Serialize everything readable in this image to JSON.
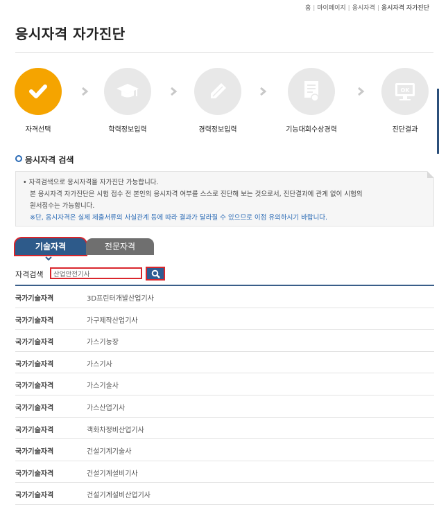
{
  "breadcrumb": {
    "items": [
      "홈",
      "마이페이지",
      "응시자격",
      "응시자격 자가진단"
    ]
  },
  "page_title": "응시자격 자가진단",
  "steps": [
    {
      "label": "자격선택",
      "icon": "check-icon",
      "active": true
    },
    {
      "label": "학력정보입력",
      "icon": "graduation-cap-icon",
      "active": false
    },
    {
      "label": "경력정보입력",
      "icon": "pencil-icon",
      "active": false
    },
    {
      "label": "기능대회수상경력",
      "icon": "certificate-icon",
      "active": false
    },
    {
      "label": "진단결과",
      "icon": "ok-monitor-icon",
      "active": false
    }
  ],
  "section_title": "응시자격 검색",
  "notice": {
    "line1": "자격검색으로 응시자격을 자가진단 가능합니다.",
    "line2": "본 응시자격 자가진단은 시험 접수 전 본인의 응시자격 여부를 스스로 진단해 보는 것으로서, 진단결과에 관계 없이 시험의",
    "line3": "원서접수는 가능합니다.",
    "line4": "※단, 응시자격은 실제 제출서류의 사실관계 등에 따라 결과가 달라질 수 있으므로 이점 유의하시기 바랍니다."
  },
  "tabs": {
    "tech": "기술자격",
    "pro": "전문자격"
  },
  "search": {
    "label": "자격검색",
    "value": "산업안전기사"
  },
  "results": [
    {
      "type": "국가기술자격",
      "name": "3D프린터개발산업기사"
    },
    {
      "type": "국가기술자격",
      "name": "가구제작산업기사"
    },
    {
      "type": "국가기술자격",
      "name": "가스기능장"
    },
    {
      "type": "국가기술자격",
      "name": "가스기사"
    },
    {
      "type": "국가기술자격",
      "name": "가스기술사"
    },
    {
      "type": "국가기술자격",
      "name": "가스산업기사"
    },
    {
      "type": "국가기술자격",
      "name": "객화차정비산업기사"
    },
    {
      "type": "국가기술자격",
      "name": "건설기계기술사"
    },
    {
      "type": "국가기술자격",
      "name": "건설기계설비기사"
    },
    {
      "type": "국가기술자격",
      "name": "건설기계설비산업기사"
    }
  ],
  "colors": {
    "accent": "#f5a400",
    "primary": "#2d5a8a",
    "highlight": "#d9262c",
    "inactive": "#e8e8e8"
  }
}
